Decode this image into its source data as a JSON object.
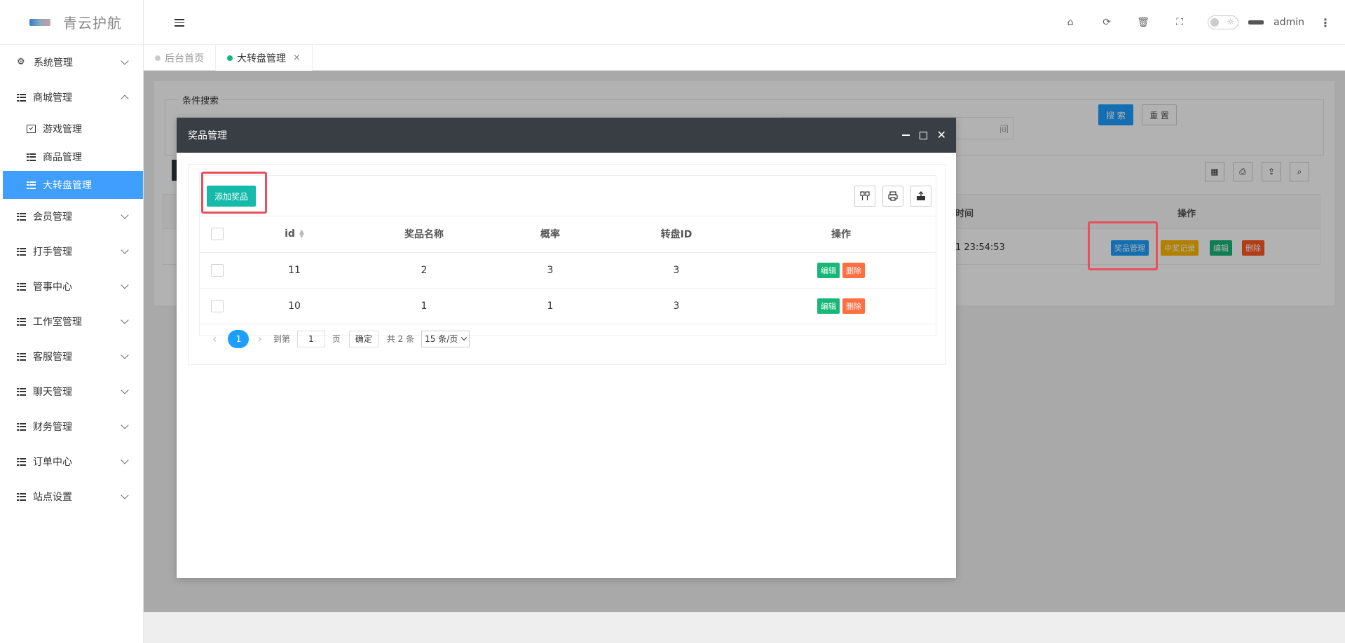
{
  "app": {
    "logo_text": "青云护航"
  },
  "sidebar": {
    "items": [
      {
        "label": "系统管理"
      },
      {
        "label": "商城管理"
      },
      {
        "label": "会员管理"
      },
      {
        "label": "打手管理"
      },
      {
        "label": "管事中心"
      },
      {
        "label": "工作室管理"
      },
      {
        "label": "客服管理"
      },
      {
        "label": "聊天管理"
      },
      {
        "label": "财务管理"
      },
      {
        "label": "订单中心"
      },
      {
        "label": "站点设置"
      }
    ],
    "sub_items": [
      {
        "label": "游戏管理"
      },
      {
        "label": "商品管理"
      },
      {
        "label": "大转盘管理"
      }
    ]
  },
  "header": {
    "username": "admin"
  },
  "tabs": [
    {
      "label": "后台首页"
    },
    {
      "label": "大转盘管理"
    }
  ],
  "background": {
    "search_legend": "条件搜索",
    "search_btn": "搜 索",
    "reset_btn": "重 置",
    "input_hint": "间",
    "col_time": "时间",
    "col_ops": "操作",
    "row_time": "1 23:54:53",
    "btn_prize": "奖品管理",
    "btn_record": "中奖记录",
    "btn_edit": "编辑",
    "btn_delete": "删除"
  },
  "dialog": {
    "title": "奖品管理",
    "add_btn": "添加奖品",
    "columns": [
      "id",
      "奖品名称",
      "概率",
      "转盘ID",
      "操作"
    ],
    "rows": [
      {
        "id": "11",
        "name": "2",
        "prob": "3",
        "wheel_id": "3"
      },
      {
        "id": "10",
        "name": "1",
        "prob": "1",
        "wheel_id": "3"
      }
    ],
    "edit_label": "编辑",
    "delete_label": "删除",
    "pager": {
      "current": "1",
      "goto_label": "到第",
      "page_value": "1",
      "page_unit": "页",
      "confirm": "确定",
      "total": "共 2 条",
      "page_size": "15 条/页"
    }
  },
  "colors": {
    "accent": "#1e9fff",
    "active_menu": "#409eff",
    "add_btn": "#16baaa",
    "highlight": "#e8505b"
  }
}
